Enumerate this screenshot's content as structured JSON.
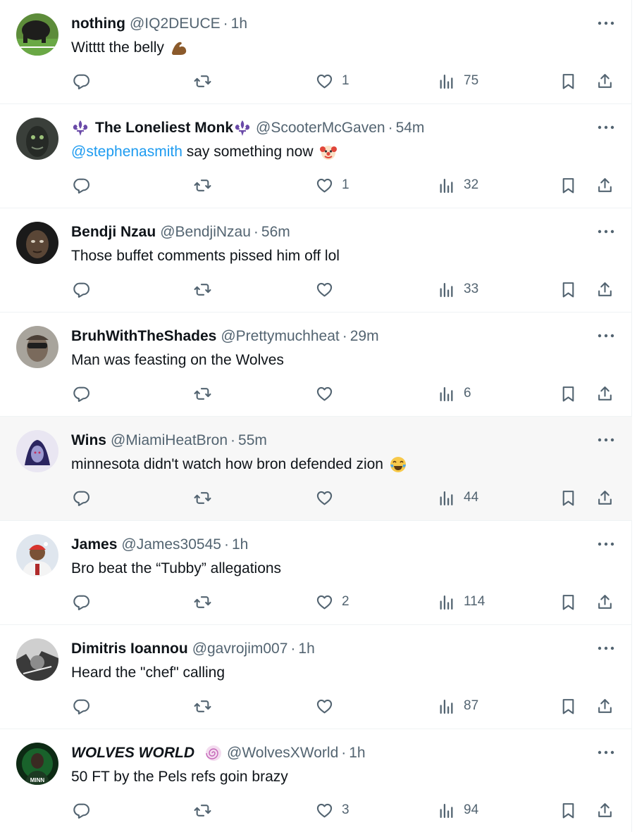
{
  "colors": {
    "text": "#0f1419",
    "muted": "#536471",
    "link": "#1d9bf0",
    "divider": "#eff3f4",
    "highlight_bg": "#f7f7f7"
  },
  "tweets": [
    {
      "name": "nothing",
      "handle": "@IQ2DEUCE",
      "sep": "·",
      "time": "1h",
      "text_before": "Witttt the belly",
      "mention": "",
      "text_after": "",
      "emoji": "flexed-biceps-icon",
      "likes": "1",
      "views": "75",
      "name_prefix_icon": "",
      "name_suffix_icon": "",
      "highlighted": false
    },
    {
      "name": "The Loneliest Monk",
      "handle": "@ScooterMcGaven",
      "sep": "·",
      "time": "54m",
      "text_before": "",
      "mention": "@stephenasmith",
      "text_after": " say something now",
      "emoji": "clown-face-icon",
      "likes": "1",
      "views": "32",
      "name_prefix_icon": "fleur-de-lis-icon",
      "name_suffix_icon": "fleur-de-lis-icon",
      "highlighted": false
    },
    {
      "name": "Bendji Nzau",
      "handle": "@BendjiNzau",
      "sep": "·",
      "time": "56m",
      "text_before": "Those buffet comments pissed him off lol",
      "mention": "",
      "text_after": "",
      "emoji": "",
      "likes": "",
      "views": "33",
      "name_prefix_icon": "",
      "name_suffix_icon": "",
      "highlighted": false
    },
    {
      "name": "BruhWithTheShades",
      "handle": "@Prettymuchheat",
      "sep": "·",
      "time": "29m",
      "text_before": "Man was feasting on the Wolves",
      "mention": "",
      "text_after": "",
      "emoji": "",
      "likes": "",
      "views": "6",
      "name_prefix_icon": "",
      "name_suffix_icon": "",
      "highlighted": false
    },
    {
      "name": "Wins",
      "handle": "@MiamiHeatBron",
      "sep": "·",
      "time": "55m",
      "text_before": "minnesota didn't watch how bron defended zion",
      "mention": "",
      "text_after": "",
      "emoji": "tears-of-joy-icon",
      "likes": "",
      "views": "44",
      "name_prefix_icon": "",
      "name_suffix_icon": "",
      "highlighted": true
    },
    {
      "name": "James",
      "handle": "@James30545",
      "sep": "·",
      "time": "1h",
      "text_before": "Bro beat the “Tubby” allegations",
      "mention": "",
      "text_after": "",
      "emoji": "",
      "likes": "2",
      "views": "114",
      "name_prefix_icon": "",
      "name_suffix_icon": "",
      "highlighted": false
    },
    {
      "name": "Dimitris Ioannou",
      "handle": "@gavrojim007",
      "sep": "·",
      "time": "1h",
      "text_before": "Heard the \"chef\" calling",
      "mention": "",
      "text_after": "",
      "emoji": "",
      "likes": "",
      "views": "87",
      "name_prefix_icon": "",
      "name_suffix_icon": "",
      "highlighted": false
    },
    {
      "name": "WOLVES WORLD",
      "handle": "@WolvesXWorld",
      "sep": "·",
      "time": "1h",
      "text_before": "50 FT by the Pels refs goin brazy",
      "mention": "",
      "text_after": "",
      "emoji": "",
      "likes": "3",
      "views": "94",
      "name_prefix_icon": "",
      "name_suffix_icon": "spiral-badge-icon",
      "highlighted": false
    }
  ]
}
